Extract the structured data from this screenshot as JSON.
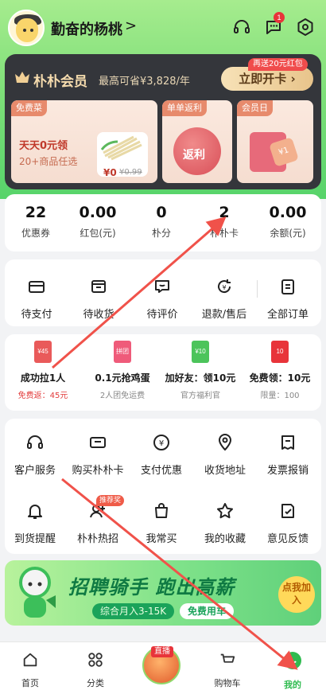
{
  "header": {
    "username": "勤奋的杨桃",
    "arrow": ">",
    "message_badge": "1",
    "icons": [
      "headset-icon",
      "message-icon",
      "settings-icon"
    ]
  },
  "member": {
    "title": "朴朴会员",
    "savings": "最高可省¥3,828/年",
    "open_button": "立即开卡",
    "open_tag": "再送20元红包",
    "cards": [
      {
        "tag": "免费菜",
        "line1": "天天0元领",
        "line2": "20+商品任选",
        "price": "¥0",
        "price_old": "¥0.99"
      },
      {
        "tag": "单单返利",
        "center": "返利"
      },
      {
        "tag": "会员日",
        "center": "¥1"
      }
    ]
  },
  "stats": [
    {
      "value": "22",
      "label": "优惠券"
    },
    {
      "value": "0.00",
      "label": "红包(元)"
    },
    {
      "value": "0",
      "label": "朴分"
    },
    {
      "value": "2",
      "label": "朴朴卡"
    },
    {
      "value": "0.00",
      "label": "余额(元)"
    }
  ],
  "orders": [
    {
      "label": "待支付",
      "icon": "wallet-icon"
    },
    {
      "label": "待收货",
      "icon": "package-icon"
    },
    {
      "label": "待评价",
      "icon": "comment-icon"
    },
    {
      "label": "退款/售后",
      "icon": "refund-icon"
    },
    {
      "label": "全部订单",
      "icon": "order-list-icon"
    }
  ],
  "promos": [
    {
      "title": "成功拉1人",
      "sub": "免费返：45元",
      "icon_text": "¥45",
      "color": "#e95a5a"
    },
    {
      "title": "0.1元抢鸡蛋",
      "sub": "2人团免运费",
      "icon_text": "拼团",
      "color": "#ef5b7a"
    },
    {
      "title": "加好友：领10元",
      "sub": "官方福利官",
      "icon_text": "¥10",
      "color": "#4cc45b"
    },
    {
      "title": "免费领：10元",
      "sub": "限量：100",
      "icon_text": "10",
      "color": "#e8343a"
    }
  ],
  "services": [
    {
      "label": "客户服务",
      "icon": "headset-icon"
    },
    {
      "label": "购买朴朴卡",
      "icon": "card-icon"
    },
    {
      "label": "支付优惠",
      "icon": "yen-icon"
    },
    {
      "label": "收货地址",
      "icon": "location-icon"
    },
    {
      "label": "发票报销",
      "icon": "invoice-icon"
    },
    {
      "label": "到货提醒",
      "icon": "bell-icon"
    },
    {
      "label": "朴朴热招",
      "icon": "recruit-icon"
    },
    {
      "label": "我常买",
      "icon": "shopping-bag-icon"
    },
    {
      "label": "我的收藏",
      "icon": "star-icon"
    },
    {
      "label": "意见反馈",
      "icon": "feedback-icon"
    }
  ],
  "hot_badge": "推荐奖",
  "banner": {
    "title": "招聘骑手 跑出高薪",
    "sub": "综合月入3-15K",
    "free": "免费用车",
    "cta": "点我加入"
  },
  "nav": {
    "items": [
      {
        "label": "首页",
        "icon": "home-icon"
      },
      {
        "label": "分类",
        "icon": "category-icon"
      },
      {
        "label": "购物车",
        "icon": "cart-icon"
      },
      {
        "label": "我的",
        "icon": "profile-icon"
      }
    ],
    "live_tag": "直播"
  },
  "colors": {
    "brand_green": "#3cc05a",
    "arrow_red": "#f0524a"
  }
}
